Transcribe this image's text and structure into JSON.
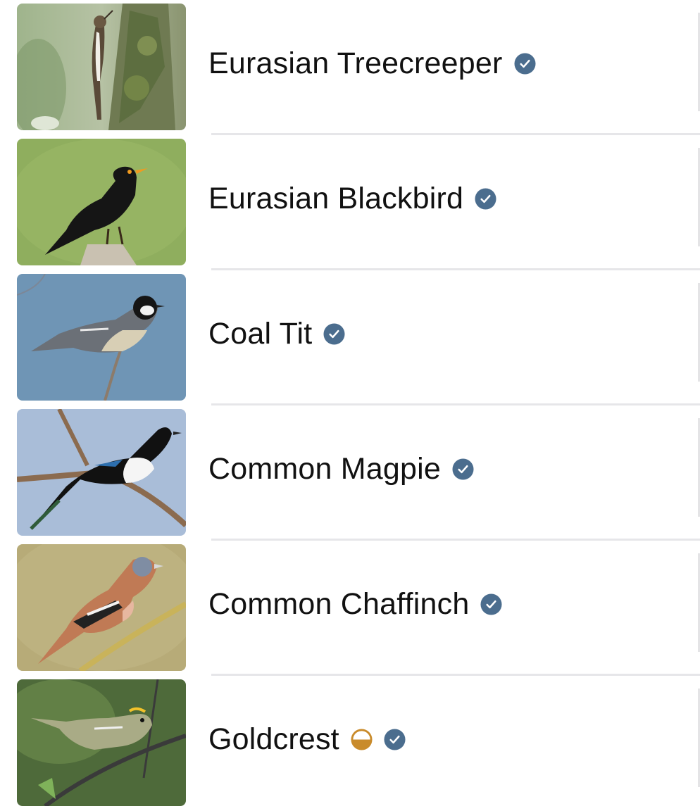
{
  "colors": {
    "verified_badge": "#4b6d8e",
    "half_badge": "#c98b2b",
    "separator": "#e6e6e9",
    "text": "#111111"
  },
  "birds": [
    {
      "name": "Eurasian Treecreeper",
      "icons": [
        "verified-badge-icon"
      ],
      "photo": "treecreeper-photo"
    },
    {
      "name": "Eurasian Blackbird",
      "icons": [
        "verified-badge-icon"
      ],
      "photo": "blackbird-photo"
    },
    {
      "name": "Coal Tit",
      "icons": [
        "verified-badge-icon"
      ],
      "photo": "coal-tit-photo"
    },
    {
      "name": "Common Magpie",
      "icons": [
        "verified-badge-icon"
      ],
      "photo": "magpie-photo"
    },
    {
      "name": "Common Chaffinch",
      "icons": [
        "verified-badge-icon"
      ],
      "photo": "chaffinch-photo"
    },
    {
      "name": "Goldcrest",
      "icons": [
        "half-circle-icon",
        "verified-badge-icon"
      ],
      "photo": "goldcrest-photo"
    }
  ]
}
